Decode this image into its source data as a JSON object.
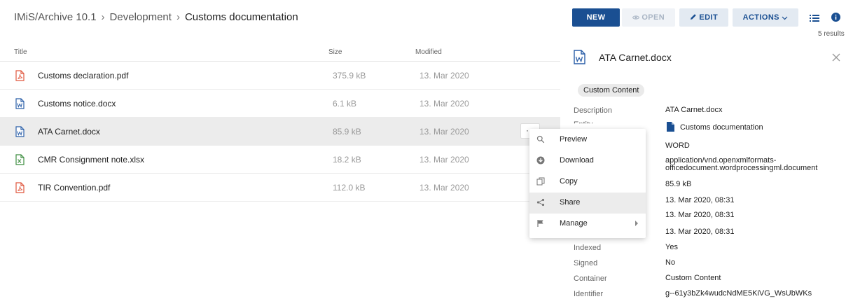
{
  "breadcrumb": [
    "IMiS/Archive 10.1",
    "Development",
    "Customs documentation"
  ],
  "breadcrumb_separator": "›",
  "table": {
    "columns": {
      "title": "Title",
      "size": "Size",
      "modified": "Modified"
    },
    "rows": [
      {
        "name": "Customs declaration.pdf",
        "size": "375.9 kB",
        "modified": "13. Mar 2020",
        "icon": "pdf-icon"
      },
      {
        "name": "Customs notice.docx",
        "size": "6.1 kB",
        "modified": "13. Mar 2020",
        "icon": "word-icon"
      },
      {
        "name": "ATA Carnet.docx",
        "size": "85.9 kB",
        "modified": "13. Mar 2020",
        "icon": "word-icon",
        "selected": true,
        "more_label": "···"
      },
      {
        "name": "CMR Consignment note.xlsx",
        "size": "18.2 kB",
        "modified": "13. Mar 2020",
        "icon": "excel-icon"
      },
      {
        "name": "TIR Convention.pdf",
        "size": "112.0 kB",
        "modified": "13. Mar 2020",
        "icon": "pdf-icon"
      }
    ]
  },
  "context_menu": {
    "items": [
      {
        "label": "Preview",
        "icon": "search-icon"
      },
      {
        "label": "Download",
        "icon": "download-icon"
      },
      {
        "label": "Copy",
        "icon": "copy-icon"
      },
      {
        "label": "Share",
        "icon": "share-icon",
        "highlighted": true
      },
      {
        "label": "Manage",
        "icon": "flag-icon",
        "submenu": true
      }
    ]
  },
  "toolbar": {
    "new_label": "NEW",
    "open_label": "OPEN",
    "edit_label": "EDIT",
    "actions_label": "ACTIONS",
    "results": "5 results"
  },
  "panel": {
    "title": "ATA Carnet.docx",
    "chip": "Custom Content",
    "properties": [
      {
        "label": "Description",
        "value": "ATA Carnet.docx"
      },
      {
        "label": "Entity",
        "value": "Customs documentation"
      },
      {
        "label": "",
        "value": "WORD"
      },
      {
        "label": "",
        "value": "application/vnd.openxmlformats-officedocument.wordprocessingml.document"
      },
      {
        "label": "",
        "value": "85.9 kB"
      },
      {
        "label": "",
        "value": "13. Mar 2020, 08:31"
      },
      {
        "label": "",
        "value": "13. Mar 2020, 08:31"
      },
      {
        "label": "",
        "value": "13. Mar 2020, 08:31"
      },
      {
        "label": "Indexed",
        "value": "Yes"
      },
      {
        "label": "Signed",
        "value": "No"
      },
      {
        "label": "Container",
        "value": "Custom Content"
      },
      {
        "label": "Identifier",
        "value": "g--61y3bZk4wudcNdME5KiVG_WsUbWKs"
      }
    ]
  },
  "colors": {
    "primary": "#1a4f92",
    "pdf": "#e0573e",
    "word": "#2b5fa8",
    "excel": "#3e8e41"
  }
}
